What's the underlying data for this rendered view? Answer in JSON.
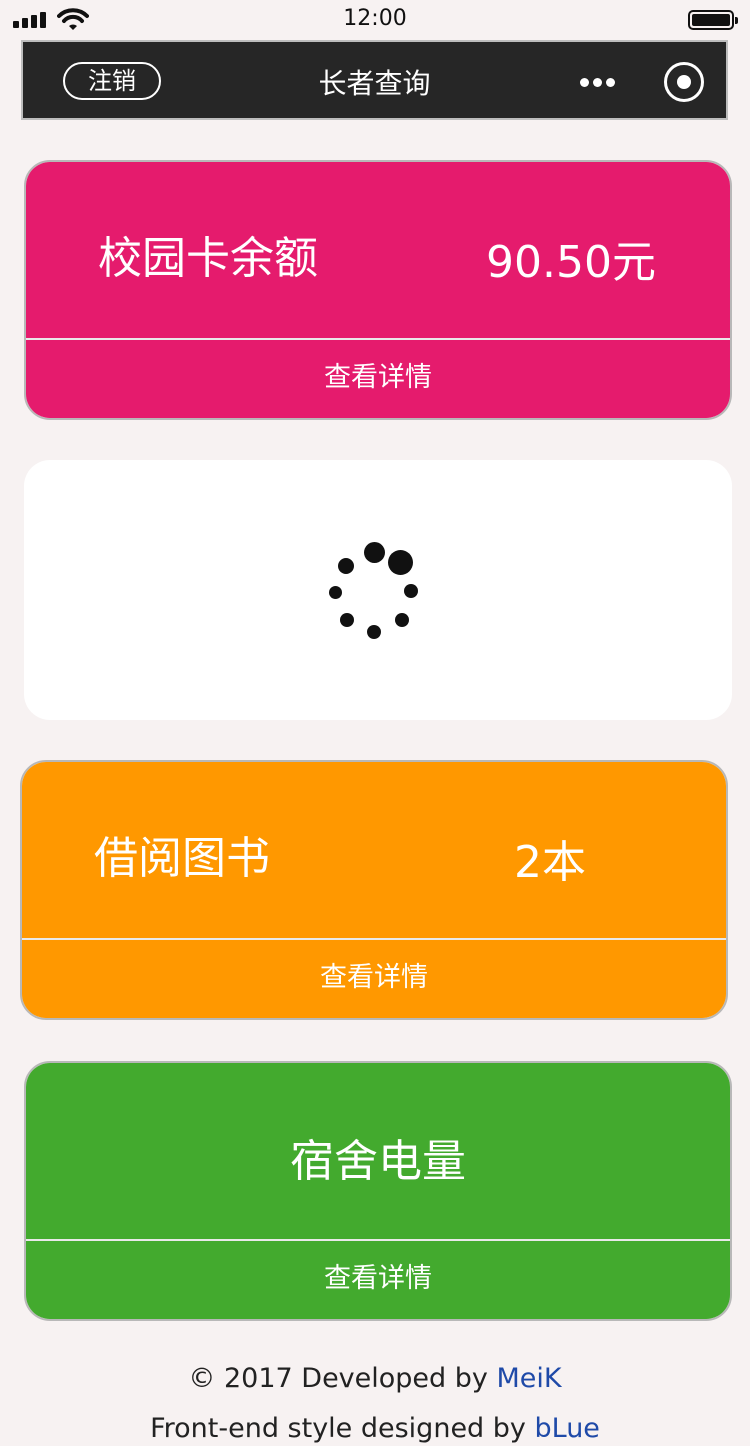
{
  "status_bar": {
    "time": "12:00",
    "icons": [
      "signal-icon",
      "wifi-icon",
      "battery-icon"
    ]
  },
  "nav": {
    "logout_label": "注销",
    "title": "长者查询",
    "icons": [
      "more-icon",
      "target-icon"
    ]
  },
  "cards": {
    "campus_card": {
      "label": "校园卡余额",
      "value": "90.50元",
      "action": "查看详情",
      "color": "#e51b6d"
    },
    "loading_card": {
      "icon": "loading-spinner-icon"
    },
    "books": {
      "label": "借阅图书",
      "value": "2本",
      "action": "查看详情",
      "color": "#ff9800"
    },
    "power": {
      "label": "宿舍电量",
      "action": "查看详情",
      "color": "#43aa2e"
    }
  },
  "footer": {
    "line1_prefix": "© 2017 Developed by ",
    "line1_link": "MeiK",
    "line2_prefix": "Front-end style designed by ",
    "line2_link": "bLue",
    "link_color": "#1f4aa8"
  }
}
